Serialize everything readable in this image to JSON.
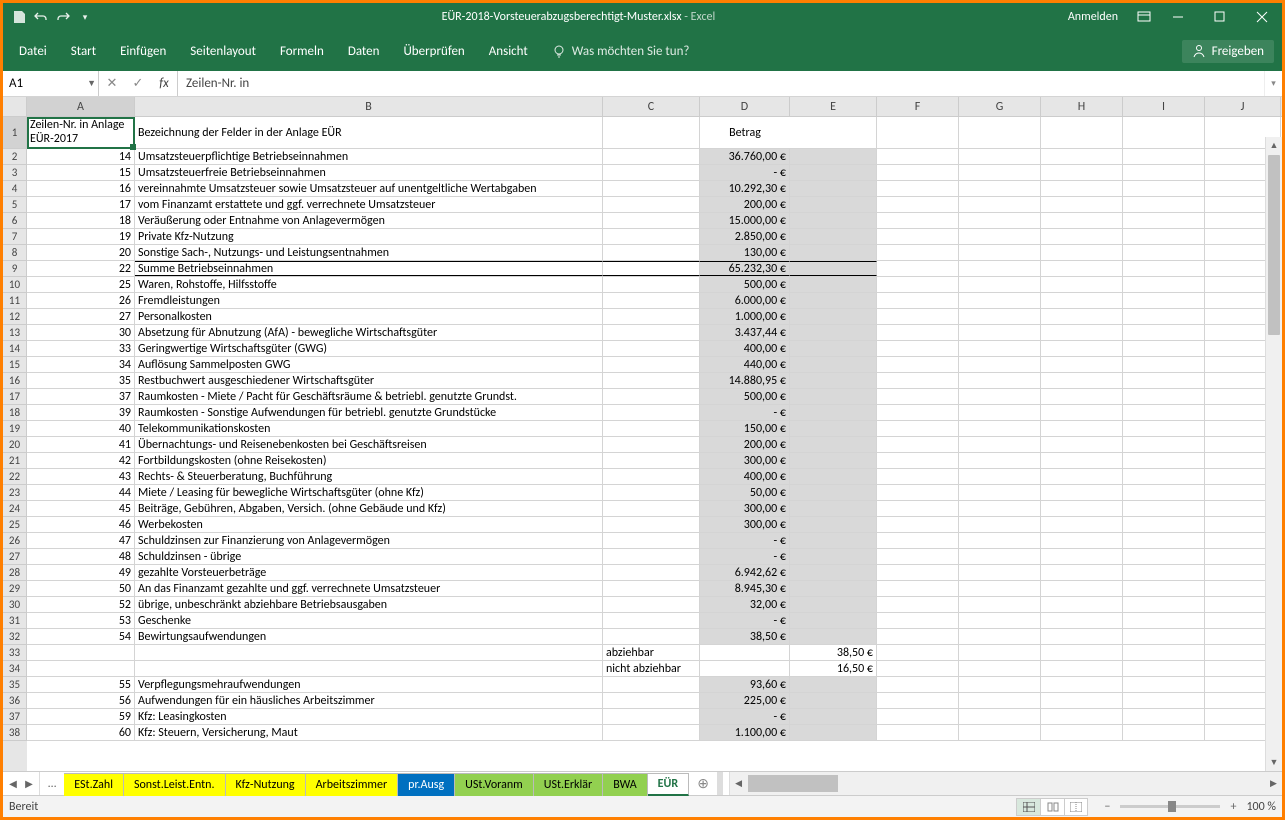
{
  "title": {
    "filename": "EÜR-2018-Vorsteuerabzugsberechtigt-Muster.xlsx",
    "app": "Excel"
  },
  "signin": "Anmelden",
  "ribbon": {
    "tabs": [
      "Datei",
      "Start",
      "Einfügen",
      "Seitenlayout",
      "Formeln",
      "Daten",
      "Überprüfen",
      "Ansicht"
    ],
    "tellme": "Was möchten Sie tun?",
    "share": "Freigeben"
  },
  "namebox": "A1",
  "formula": "Zeilen-Nr. in",
  "columns": [
    "A",
    "B",
    "C",
    "D",
    "E",
    "F",
    "G",
    "H",
    "I",
    "J"
  ],
  "header_row": {
    "a": "Zeilen-Nr. in Anlage EÜR-2017",
    "b": "Bezeichnung der Felder in der Anlage EÜR",
    "d": "Betrag"
  },
  "rows": [
    {
      "n": 2,
      "a": "14",
      "b": "Umsatzsteuerpflichtige Betriebseinnahmen",
      "d": "36.760,00 €",
      "shade": true
    },
    {
      "n": 3,
      "a": "15",
      "b": "Umsatzsteuerfreie Betriebseinnahmen",
      "d": "-   €",
      "shade": true
    },
    {
      "n": 4,
      "a": "16",
      "b": "vereinnahmte Umsatzsteuer sowie Umsatzsteuer auf unentgeltliche Wertabgaben",
      "d": "10.292,30 €",
      "shade": true
    },
    {
      "n": 5,
      "a": "17",
      "b": "vom Finanzamt erstattete und ggf. verrechnete Umsatzsteuer",
      "d": "200,00 €",
      "shade": true
    },
    {
      "n": 6,
      "a": "18",
      "b": "Veräußerung oder Entnahme von Anlagevermögen",
      "d": "15.000,00 €",
      "shade": true
    },
    {
      "n": 7,
      "a": "19",
      "b": "Private Kfz-Nutzung",
      "d": "2.850,00 €",
      "shade": true
    },
    {
      "n": 8,
      "a": "20",
      "b": "Sonstige Sach-, Nutzungs- und Leistungsentnahmen",
      "d": "130,00 €",
      "shade": true
    },
    {
      "n": 9,
      "a": "22",
      "b": "Summe Betriebseinnahmen",
      "d": "65.232,30 €",
      "shade": true,
      "sum": true
    },
    {
      "n": 10,
      "a": "25",
      "b": "Waren, Rohstoffe, Hilfsstoffe",
      "d": "500,00 €",
      "shade": true
    },
    {
      "n": 11,
      "a": "26",
      "b": "Fremdleistungen",
      "d": "6.000,00 €",
      "shade": true
    },
    {
      "n": 12,
      "a": "27",
      "b": "Personalkosten",
      "d": "1.000,00 €",
      "shade": true
    },
    {
      "n": 13,
      "a": "30",
      "b": "Absetzung für Abnutzung (AfA) - bewegliche Wirtschaftsgüter",
      "d": "3.437,44 €",
      "shade": true
    },
    {
      "n": 14,
      "a": "33",
      "b": "Geringwertige Wirtschaftsgüter (GWG)",
      "d": "400,00 €",
      "shade": true
    },
    {
      "n": 15,
      "a": "34",
      "b": "Auflösung Sammelposten GWG",
      "d": "440,00 €",
      "shade": true
    },
    {
      "n": 16,
      "a": "35",
      "b": "Restbuchwert ausgeschiedener Wirtschaftsgüter",
      "d": "14.880,95 €",
      "shade": true
    },
    {
      "n": 17,
      "a": "37",
      "b": "Raumkosten - Miete / Pacht für Geschäftsräume & betriebl. genutzte Grundst.",
      "d": "500,00 €",
      "shade": true
    },
    {
      "n": 18,
      "a": "39",
      "b": "Raumkosten - Sonstige Aufwendungen für betriebl. genutzte Grundstücke",
      "d": "-   €",
      "shade": true
    },
    {
      "n": 19,
      "a": "40",
      "b": "Telekommunikationskosten",
      "d": "150,00 €",
      "shade": true
    },
    {
      "n": 20,
      "a": "41",
      "b": "Übernachtungs- und Reisenebenkosten bei Geschäftsreisen",
      "d": "200,00 €",
      "shade": true
    },
    {
      "n": 21,
      "a": "42",
      "b": "Fortbildungskosten (ohne Reisekosten)",
      "d": "300,00 €",
      "shade": true
    },
    {
      "n": 22,
      "a": "43",
      "b": "Rechts- & Steuerberatung, Buchführung",
      "d": "400,00 €",
      "shade": true
    },
    {
      "n": 23,
      "a": "44",
      "b": "Miete / Leasing für bewegliche Wirtschaftsgüter (ohne Kfz)",
      "d": "50,00 €",
      "shade": true
    },
    {
      "n": 24,
      "a": "45",
      "b": "Beiträge, Gebühren, Abgaben, Versich. (ohne Gebäude und Kfz)",
      "d": "300,00 €",
      "shade": true
    },
    {
      "n": 25,
      "a": "46",
      "b": "Werbekosten",
      "d": "300,00 €",
      "shade": true
    },
    {
      "n": 26,
      "a": "47",
      "b": "Schuldzinsen zur Finanzierung von Anlagevermögen",
      "d": "-   €",
      "shade": true
    },
    {
      "n": 27,
      "a": "48",
      "b": "Schuldzinsen - übrige",
      "d": "-   €",
      "shade": true
    },
    {
      "n": 28,
      "a": "49",
      "b": "gezahlte Vorsteuerbeträge",
      "d": "6.942,62 €",
      "shade": true
    },
    {
      "n": 29,
      "a": "50",
      "b": "An das Finanzamt gezahlte und ggf. verrechnete Umsatzsteuer",
      "d": "8.945,30 €",
      "shade": true
    },
    {
      "n": 30,
      "a": "52",
      "b": "übrige, unbeschränkt abziehbare Betriebsausgaben",
      "d": "32,00 €",
      "shade": true
    },
    {
      "n": 31,
      "a": "53",
      "b": "Geschenke",
      "d": "-   €",
      "shade": true
    },
    {
      "n": 32,
      "a": "54",
      "b": "Bewirtungsaufwendungen",
      "d": "38,50 €",
      "shade": true
    },
    {
      "n": 33,
      "a": "",
      "b": "",
      "c": "abziehbar",
      "e": "38,50 €"
    },
    {
      "n": 34,
      "a": "",
      "b": "",
      "c": "nicht abziehbar",
      "e": "16,50 €"
    },
    {
      "n": 35,
      "a": "55",
      "b": "Verpflegungsmehraufwendungen",
      "d": "93,60 €",
      "shade": true
    },
    {
      "n": 36,
      "a": "56",
      "b": "Aufwendungen für ein häusliches Arbeitszimmer",
      "d": "225,00 €",
      "shade": true
    },
    {
      "n": 37,
      "a": "59",
      "b": "Kfz: Leasingkosten",
      "d": "-   €",
      "shade": true
    },
    {
      "n": 38,
      "a": "60",
      "b": "Kfz: Steuern, Versicherung, Maut",
      "d": "1.100,00 €",
      "shade": true
    }
  ],
  "sheets": {
    "items": [
      {
        "label": "ESt.Zahl",
        "cls": "yellow"
      },
      {
        "label": "Sonst.Leist.Entn.",
        "cls": "yellow"
      },
      {
        "label": "Kfz-Nutzung",
        "cls": "yellow"
      },
      {
        "label": "Arbeitszimmer",
        "cls": "yellow"
      },
      {
        "label": "pr.Ausg",
        "cls": "blue"
      },
      {
        "label": "USt.Voranm",
        "cls": "green"
      },
      {
        "label": "USt.Erklär",
        "cls": "green"
      },
      {
        "label": "BWA",
        "cls": "green"
      },
      {
        "label": "EÜR",
        "cls": "active"
      }
    ]
  },
  "status": {
    "ready": "Bereit",
    "zoom": "100 %"
  }
}
